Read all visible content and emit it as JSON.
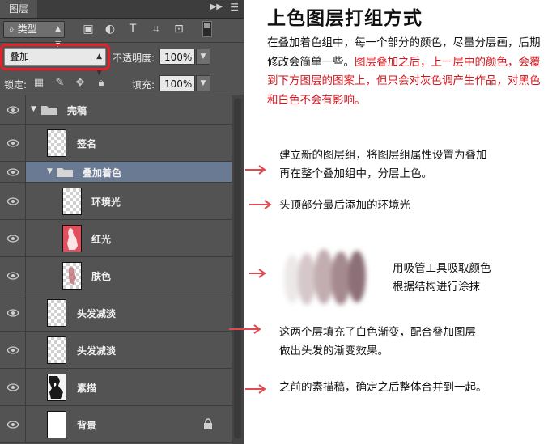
{
  "panel": {
    "tab_label": "图层",
    "collapse_icon": "double-chevron-icon",
    "menu_icon": "panel-menu-icon",
    "filter": {
      "icon": "search-icon",
      "selected": "类型"
    },
    "filter_icons": [
      "image-filter-icon",
      "adjustment-filter-icon",
      "type-filter-icon",
      "shape-filter-icon",
      "smart-object-filter-icon"
    ],
    "blend_mode": "叠加",
    "opacity_label": "不透明度:",
    "opacity_value": "100%",
    "lock_label": "锁定:",
    "lock_icons": [
      "lock-transparent-icon",
      "lock-brush-icon",
      "lock-move-icon",
      "lock-all-icon"
    ],
    "fill_label": "填充:",
    "fill_value": "100%",
    "layers": [
      {
        "name": "完稿",
        "kind": "group"
      },
      {
        "name": "签名",
        "kind": "layer"
      },
      {
        "name": "叠加着色",
        "kind": "group"
      },
      {
        "name": "环境光",
        "kind": "layer"
      },
      {
        "name": "红光",
        "kind": "layer"
      },
      {
        "name": "肤色",
        "kind": "layer"
      },
      {
        "name": "头发减淡",
        "kind": "layer"
      },
      {
        "name": "头发减淡",
        "kind": "layer"
      },
      {
        "name": "素描",
        "kind": "layer"
      },
      {
        "name": "背景",
        "kind": "layer",
        "locked": true
      }
    ]
  },
  "annotations": {
    "title": "上色图层打组方式",
    "intro_black": "在叠加着色组中，每一个部分的颜色，尽量分层画，后期修改会简单一些。",
    "intro_red": "图层叠加之后，上一层中的颜色，会覆到下方图层的图案上，但只会对灰色调产生作品，对黑色和白色不会有影响。",
    "notes": [
      "建立新的图层组，将图层组属性设置为叠加\n再在整个叠加组中，分层上色。",
      "头顶部分最后添加的环境光",
      "用吸管工具吸取颜色\n根据结构进行涂抹",
      "这两个层填充了白色渐变，配合叠加图层\n做出头发的渐变效果。",
      "之前的素描稿，确定之后整体合并到一起。"
    ]
  },
  "colors": {
    "panel_bg": "#535353",
    "highlight": "#e8202a",
    "arrow": "#e04a50",
    "note_red": "#d4151c"
  }
}
